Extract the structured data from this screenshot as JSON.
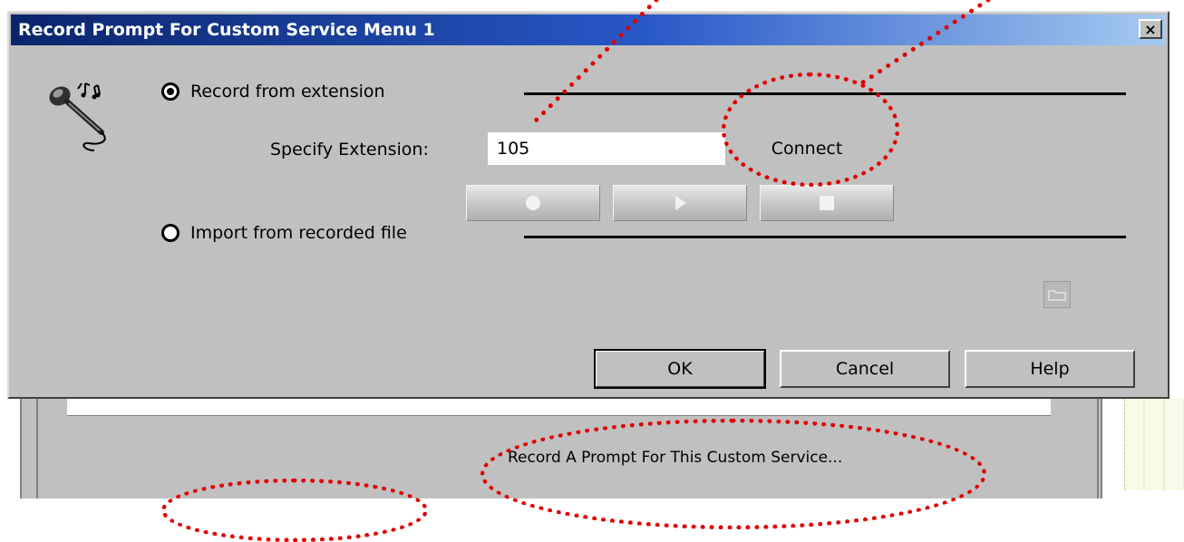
{
  "dialog": {
    "title": "Record Prompt For Custom Service Menu 1",
    "close_label": "×"
  },
  "record": {
    "option_label": "Record from extension",
    "selected": true,
    "extension_label": "Specify Extension:",
    "extension_value": "105",
    "connect_label": "Connect"
  },
  "import": {
    "option_label": "Import from recorded file",
    "selected": false
  },
  "buttons": {
    "ok": "OK",
    "cancel": "Cancel",
    "help": "Help"
  },
  "background": {
    "status_text": "Record A Prompt For This Custom Service..."
  },
  "colors": {
    "title_bar_start": "#0a246a",
    "title_bar_end": "#a6caf0",
    "dialog_face": "#c0c0c0",
    "annotation": "#e00000"
  },
  "icons": {
    "app": "microphone-icon",
    "record": "record-icon",
    "play": "play-icon",
    "stop": "stop-icon",
    "browse": "folder-browse-icon"
  }
}
